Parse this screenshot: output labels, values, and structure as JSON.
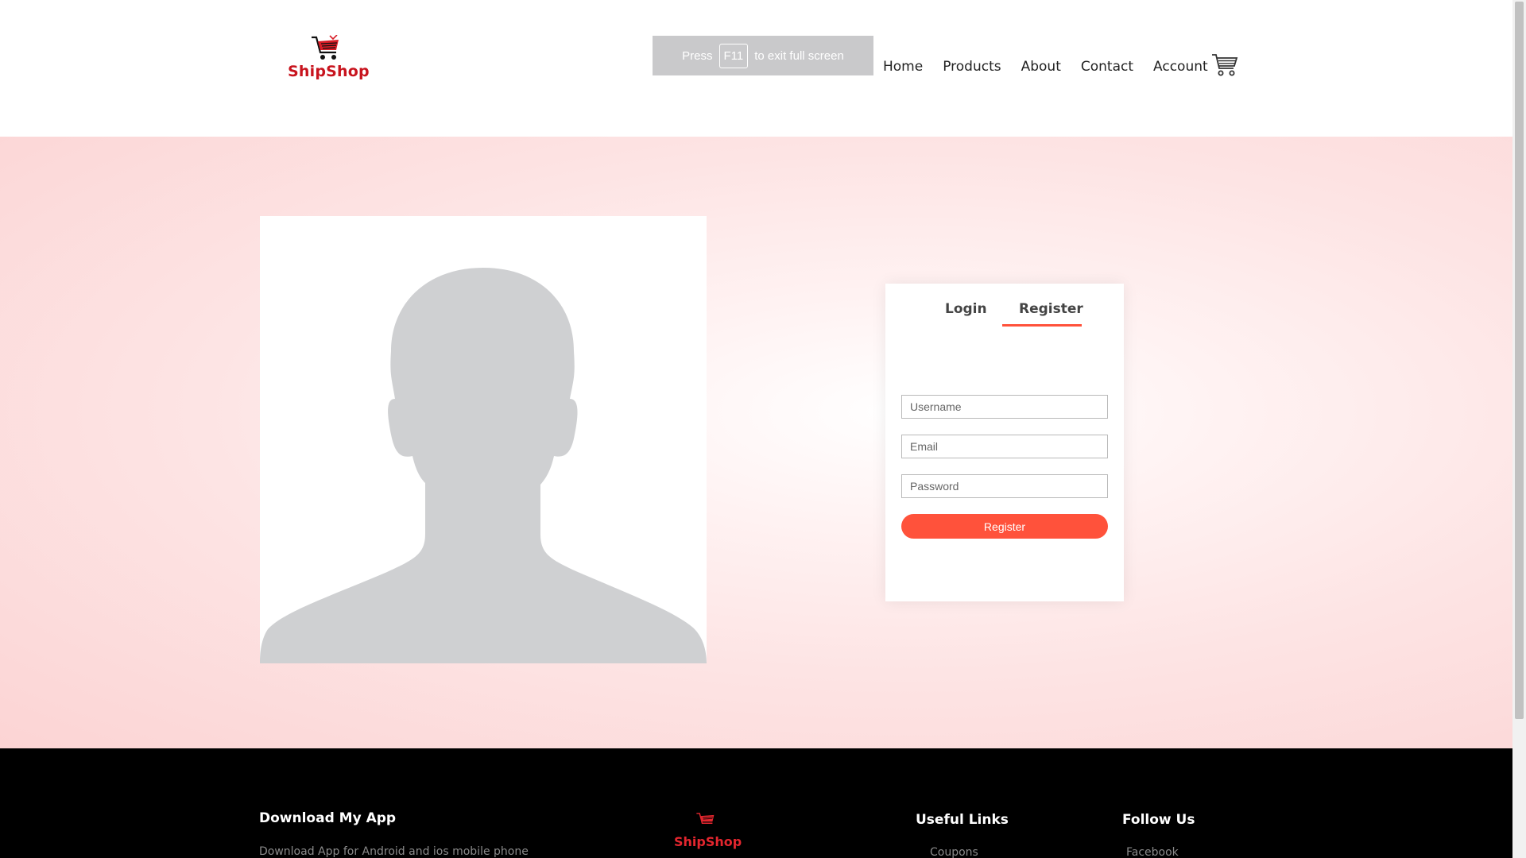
{
  "header": {
    "logo_text": "ShipShop",
    "fullscreen_notice": {
      "prefix": "Press",
      "key": "F11",
      "suffix": "to exit full screen"
    },
    "nav": {
      "home": "Home",
      "products": "Products",
      "about": "About",
      "contact": "Contact",
      "account": "Account"
    },
    "cart_icon": "cart-icon"
  },
  "main": {
    "avatar_icon": "user-silhouette-icon",
    "form": {
      "tab_login": "Login",
      "tab_register": "Register",
      "active_tab": "Register",
      "username_placeholder": "Username",
      "email_placeholder": "Email",
      "password_placeholder": "Password",
      "register_button": "Register"
    }
  },
  "footer": {
    "download_heading": "Download My App",
    "download_text": "Download App for Android and ios mobile phone",
    "logo_text": "ShipShop",
    "useful_links_heading": "Useful Links",
    "useful_links": [
      "Coupons"
    ],
    "follow_heading": "Follow Us",
    "follow_links": [
      "Facebook"
    ]
  },
  "colors": {
    "brand": "#c8141e",
    "accent": "#ff523b",
    "footer_bg": "#000000",
    "main_bg": "#fcd4d4"
  }
}
